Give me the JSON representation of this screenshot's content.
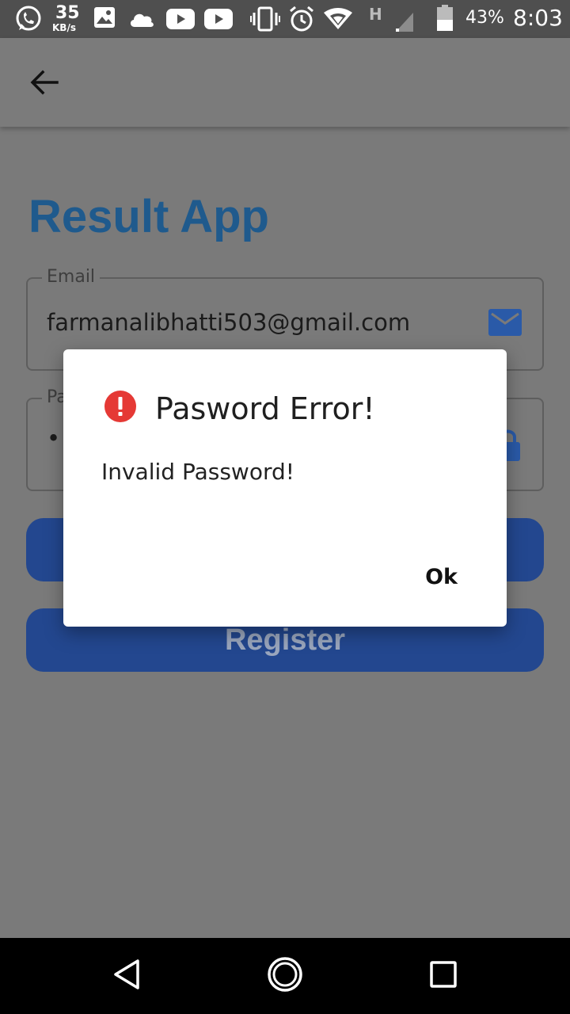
{
  "status_bar": {
    "speed_value": "35",
    "speed_unit": "KB/s",
    "network_type": "H",
    "battery": "43%",
    "time": "8:03",
    "icons": [
      "whatsapp-icon",
      "image-icon",
      "cloud-icon",
      "youtube-icon",
      "youtube-icon",
      "vibrate-icon",
      "alarm-icon",
      "wifi-icon",
      "signal-icon",
      "battery-icon"
    ]
  },
  "app_bar": {
    "back_icon": "arrow-left-icon"
  },
  "main": {
    "title": "Result App",
    "email": {
      "label": "Email",
      "value": "farmanalibhatti503@gmail.com",
      "icon": "mail-icon"
    },
    "password": {
      "label": "Pa",
      "value": "••",
      "icon": "lock-icon"
    },
    "login_button": "",
    "register_button": "Register"
  },
  "dialog": {
    "title": "Pasword Error!",
    "message": "Invalid Password!",
    "ok_label": "Ok",
    "icon": "error-icon"
  },
  "nav_bar": {
    "icons": [
      "back-triangle-icon",
      "home-circle-icon",
      "recents-square-icon"
    ]
  },
  "colors": {
    "accent": "#1f5a8d",
    "button": "#23478f",
    "error": "#e53935",
    "scrim": "#7a7a7a"
  }
}
